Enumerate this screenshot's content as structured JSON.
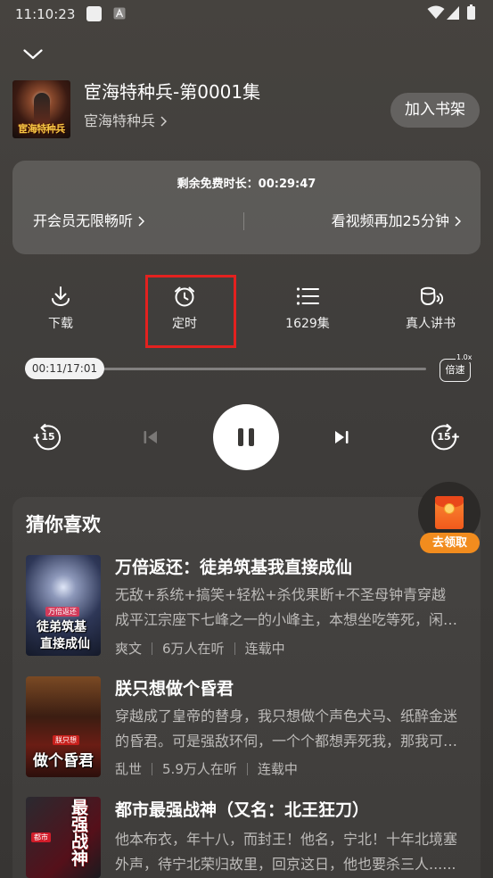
{
  "status_bar": {
    "time": "11:10:23",
    "notification_icons": [
      "square-icon",
      "a-icon"
    ],
    "system_icons": [
      "wifi-icon",
      "signal-icon",
      "battery-icon"
    ]
  },
  "header": {
    "collapse_icon": "chevron-down-icon"
  },
  "book": {
    "cover_text": "宦海特种兵",
    "title": "宦海特种兵-第0001集",
    "author_link": "宦海特种兵",
    "add_to_shelf": "加入书架"
  },
  "free_panel": {
    "remaining_label": "剩余免费时长：",
    "remaining_time": "00:29:47",
    "vip_link": "开会员无限畅听",
    "video_link": "看视频再加25分钟"
  },
  "actions": [
    {
      "icon": "download-icon",
      "label": "下载"
    },
    {
      "icon": "alarm-clock-icon",
      "label": "定时"
    },
    {
      "icon": "episode-list-icon",
      "label": "1629集"
    },
    {
      "icon": "human-narration-icon",
      "label": "真人讲书"
    }
  ],
  "progress": {
    "time_display": "00:11/17:01",
    "played_fraction": 0.011,
    "speed_label": "倍速",
    "speed_value": "1.0x"
  },
  "playback": {
    "rewind_seconds": "15",
    "forward_seconds": "15",
    "icons": [
      "rewind-15-icon",
      "skip-previous-icon",
      "pause-icon",
      "skip-next-icon",
      "forward-15-icon"
    ]
  },
  "reward": {
    "icon": "red-envelope-icon",
    "label": "去领取"
  },
  "recommendations": {
    "title": "猜你喜欢",
    "items": [
      {
        "cover_text": [
          "万倍返还",
          "徒弟筑基",
          "直接成仙"
        ],
        "title": "万倍返还：徒弟筑基我直接成仙",
        "description": "无敌+系统+搞笑+轻松+杀伐果断+不圣母钟青穿越成平江宗座下七峰之一的小峰主，本想坐吃等死，闲鱼一生...",
        "tags": [
          "爽文",
          "6万人在听",
          "连载中"
        ]
      },
      {
        "cover_text": [
          "朕只想",
          "做个昏君"
        ],
        "title": "朕只想做个昏君",
        "description": "穿越成了皇帝的替身，我只想做个声色犬马、纸醉金迷的昏君。可是强敌环伺，一个个都想弄死我，那我可就...",
        "tags": [
          "乱世",
          "5.9万人在听",
          "连载中"
        ]
      },
      {
        "cover_text": [
          "都市",
          "最强战神"
        ],
        "title": "都市最强战神（又名：北王狂刀）",
        "description": "他本布衣，年十八，而封王！他名，宁北！十年北境塞外声，待宁北荣归故里，回京这日，他也要杀三人......"
      }
    ]
  },
  "colors": {
    "background": "#3f3d3b",
    "panel": "#5a5856",
    "accent": "#f28c1e",
    "highlight": "#e3211f",
    "text_secondary": "#bdbbb9"
  }
}
